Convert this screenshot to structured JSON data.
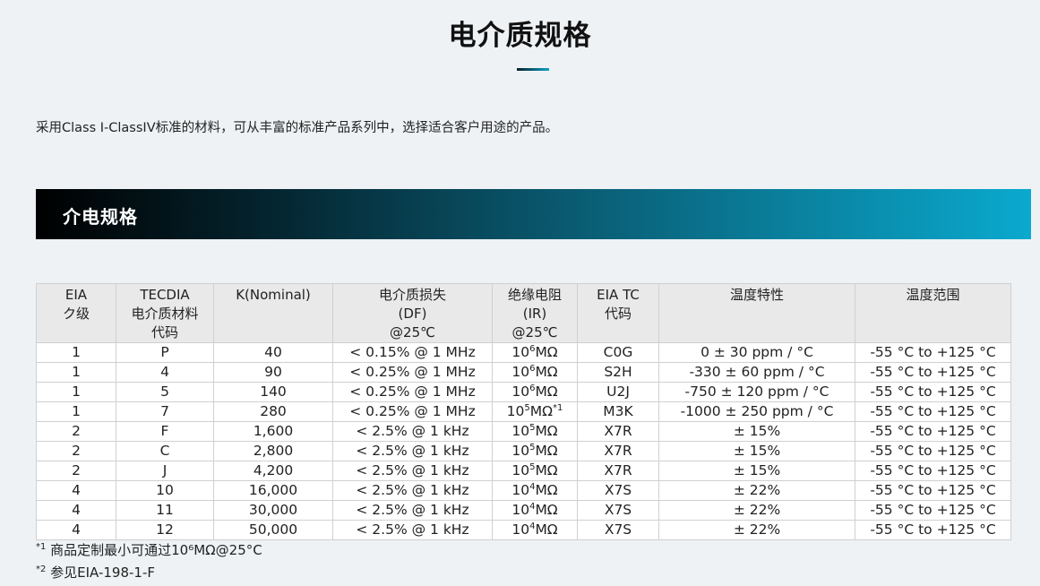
{
  "page": {
    "title": "电介质规格",
    "intro": "采用Class I-ClassIV标准的材料，可从丰富的标准产品系列中，选择适合客户用途的产品。",
    "section_title": "介电规格"
  },
  "table": {
    "headers": [
      {
        "lines": [
          "EIA",
          "ク级"
        ],
        "sup": "*2"
      },
      {
        "lines": [
          "TECDIA",
          "电介质材料",
          "代码"
        ],
        "sup": ""
      },
      {
        "lines": [
          "K(Nominal)"
        ],
        "sup": ""
      },
      {
        "lines": [
          "电介质损失",
          "(DF)",
          "@25℃"
        ],
        "sup": ""
      },
      {
        "lines": [
          "绝缘电阻(IR)",
          "@25℃"
        ],
        "sup": ""
      },
      {
        "lines": [
          "EIA TC",
          "代码"
        ],
        "sup": "*2"
      },
      {
        "lines": [
          "温度特性"
        ],
        "sup": ""
      },
      {
        "lines": [
          "温度范围"
        ],
        "sup": ""
      }
    ],
    "rows": [
      {
        "eia_class": "1",
        "code": "P",
        "k": "40",
        "df": "< 0.15% @ 1 MHz",
        "ir_base": "10",
        "ir_exp": "6",
        "ir_unit": "MΩ",
        "ir_note": "",
        "tc_code": "C0G",
        "tc": "0 ± 30 ppm / °C",
        "range": "-55 °C to +125 °C"
      },
      {
        "eia_class": "1",
        "code": "4",
        "k": "90",
        "df": "< 0.25% @ 1 MHz",
        "ir_base": "10",
        "ir_exp": "6",
        "ir_unit": "MΩ",
        "ir_note": "",
        "tc_code": "S2H",
        "tc": "-330 ± 60 ppm / °C",
        "range": "-55 °C to +125 °C"
      },
      {
        "eia_class": "1",
        "code": "5",
        "k": "140",
        "df": "< 0.25% @ 1 MHz",
        "ir_base": "10",
        "ir_exp": "6",
        "ir_unit": "MΩ",
        "ir_note": "",
        "tc_code": "U2J",
        "tc": "-750 ± 120 ppm / °C",
        "range": "-55 °C to +125 °C"
      },
      {
        "eia_class": "1",
        "code": "7",
        "k": "280",
        "df": "< 0.25% @ 1 MHz",
        "ir_base": "10",
        "ir_exp": "5",
        "ir_unit": "MΩ",
        "ir_note": "*1",
        "tc_code": "M3K",
        "tc": "-1000 ± 250 ppm / °C",
        "range": "-55 °C to +125 °C"
      },
      {
        "eia_class": "2",
        "code": "F",
        "k": "1,600",
        "df": "< 2.5% @ 1 kHz",
        "ir_base": "10",
        "ir_exp": "5",
        "ir_unit": "MΩ",
        "ir_note": "",
        "tc_code": "X7R",
        "tc": "± 15%",
        "range": "-55 °C to +125 °C"
      },
      {
        "eia_class": "2",
        "code": "C",
        "k": "2,800",
        "df": "< 2.5% @ 1 kHz",
        "ir_base": "10",
        "ir_exp": "5",
        "ir_unit": "MΩ",
        "ir_note": "",
        "tc_code": "X7R",
        "tc": "± 15%",
        "range": "-55 °C to +125 °C"
      },
      {
        "eia_class": "2",
        "code": "J",
        "k": "4,200",
        "df": "< 2.5% @ 1 kHz",
        "ir_base": "10",
        "ir_exp": "5",
        "ir_unit": "MΩ",
        "ir_note": "",
        "tc_code": "X7R",
        "tc": "± 15%",
        "range": "-55 °C to +125 °C"
      },
      {
        "eia_class": "4",
        "code": "10",
        "k": "16,000",
        "df": "< 2.5% @ 1 kHz",
        "ir_base": "10",
        "ir_exp": "4",
        "ir_unit": "MΩ",
        "ir_note": "",
        "tc_code": "X7S",
        "tc": "± 22%",
        "range": "-55 °C to +125 °C"
      },
      {
        "eia_class": "4",
        "code": "11",
        "k": "30,000",
        "df": "< 2.5% @ 1 kHz",
        "ir_base": "10",
        "ir_exp": "4",
        "ir_unit": "MΩ",
        "ir_note": "",
        "tc_code": "X7S",
        "tc": "± 22%",
        "range": "-55 °C to +125 °C"
      },
      {
        "eia_class": "4",
        "code": "12",
        "k": "50,000",
        "df": "< 2.5% @ 1 kHz",
        "ir_base": "10",
        "ir_exp": "4",
        "ir_unit": "MΩ",
        "ir_note": "",
        "tc_code": "X7S",
        "tc": "± 22%",
        "range": "-55 °C to +125 °C"
      }
    ]
  },
  "footnotes": [
    {
      "mark": "*1",
      "text": " 商品定制最小可通过10⁶MΩ@25°C"
    },
    {
      "mark": "*2",
      "text": " 参见EIA-198-1-F"
    }
  ],
  "colors": {
    "background": "#eef2f5",
    "banner_start": "#000000",
    "banner_end": "#0aa9ce",
    "header_cell": "#e9e9e9",
    "accent": "#0aa3c7"
  }
}
